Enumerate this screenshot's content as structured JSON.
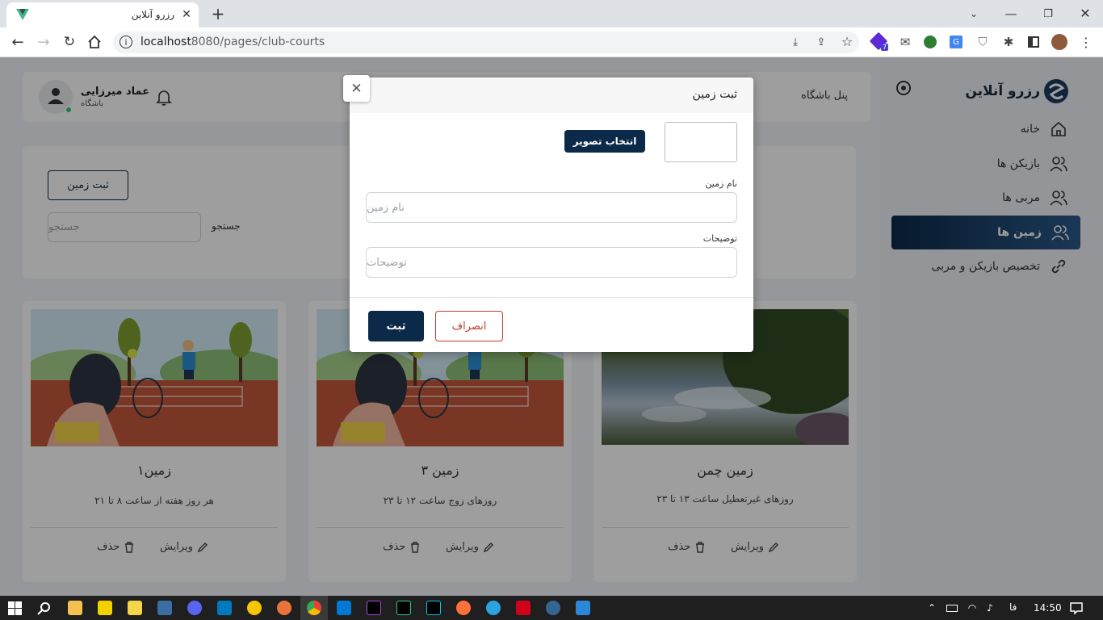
{
  "browser": {
    "tab_title": "رزرو آنلاین",
    "url_host": "localhost",
    "url_rest": ":8080/pages/club-courts",
    "extension_badge": "7"
  },
  "sidebar": {
    "brand": "رزرو آنلاین",
    "items": [
      {
        "label": "خانه",
        "icon": "home-icon",
        "active": false
      },
      {
        "label": "بازیکن ها",
        "icon": "users-icon",
        "active": false
      },
      {
        "label": "مربی ها",
        "icon": "users-icon",
        "active": false
      },
      {
        "label": "زمین ها",
        "icon": "users-icon",
        "active": true
      },
      {
        "label": "تخصیص بازیکن و مربی",
        "icon": "link-icon",
        "active": false
      }
    ]
  },
  "header": {
    "panel_title": "پنل باشگاه",
    "user_name": "عماد میرزایی",
    "user_role": "باشگاه"
  },
  "filters": {
    "add_button": "ثبت زمین",
    "search_label": "جستجو",
    "search_placeholder": "جستجو"
  },
  "courts": [
    {
      "title": "زمین۱",
      "description": "هر روز هفته از ساعت ۸ تا ۲۱",
      "edit_label": "ویرایش",
      "delete_label": "حذف",
      "image": "tennis-illustration"
    },
    {
      "title": "زمین ۳",
      "description": "روزهای زوج ساعت ۱۲ تا ۲۳",
      "edit_label": "ویرایش",
      "delete_label": "حذف",
      "image": "tennis-illustration"
    },
    {
      "title": "زمین چمن",
      "description": "روزهای غیرتعطیل ساعت ۱۳ تا ۲۳",
      "edit_label": "ویرایش",
      "delete_label": "حذف",
      "image": "lake-photo"
    }
  ],
  "modal": {
    "title": "ثبت زمین",
    "choose_image": "انتخاب تصویر",
    "name_label": "نام زمین",
    "name_placeholder": "نام زمین",
    "desc_label": "توضیحات",
    "desc_placeholder": "توضیحات",
    "submit": "ثبت",
    "cancel": "انصراف"
  },
  "taskbar": {
    "language": "فا",
    "time": "14:50"
  },
  "colors": {
    "primary": "#0b2a4a",
    "cancel_red": "#c0392b",
    "page_bg": "#f2f4f8",
    "online_green": "#2ecc71"
  }
}
